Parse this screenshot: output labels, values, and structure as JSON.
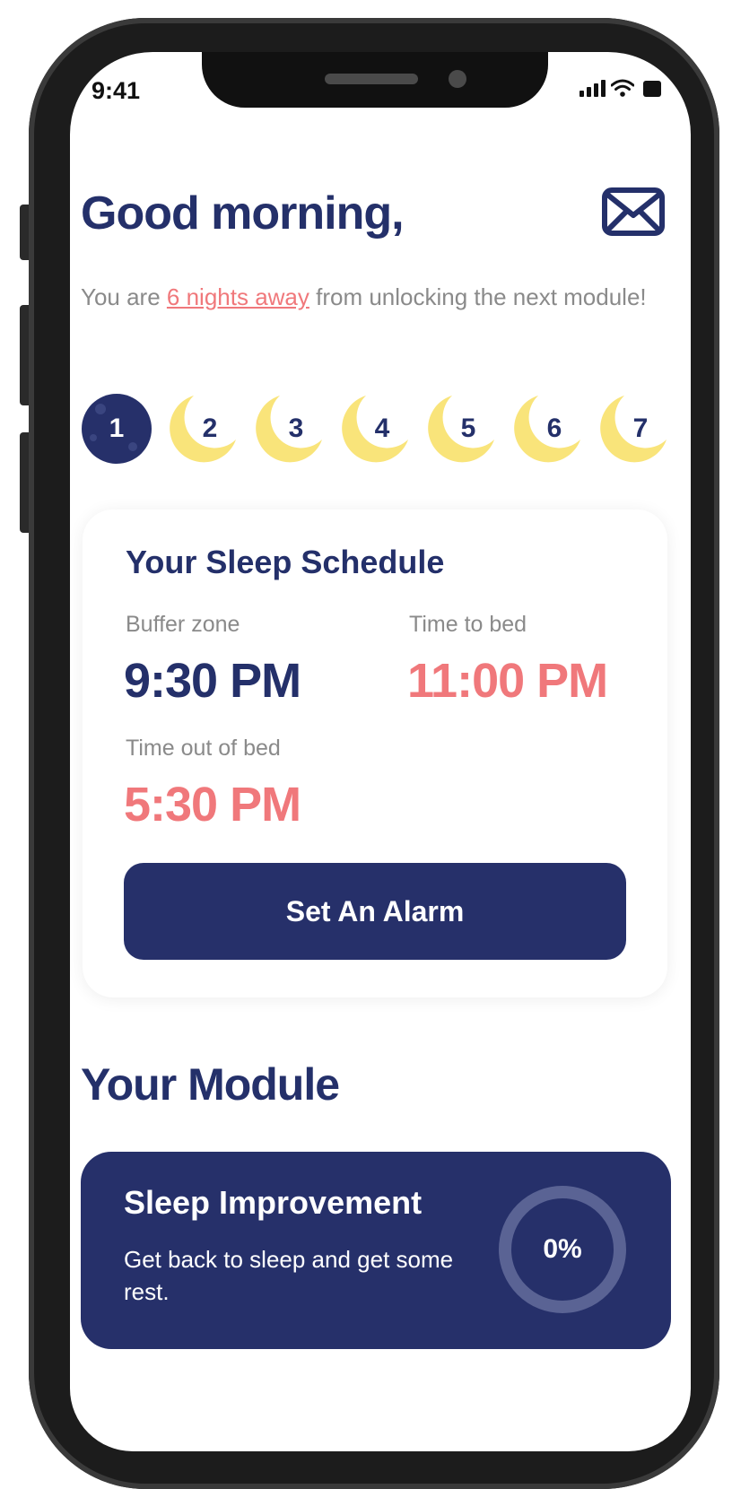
{
  "status_bar": {
    "time": "9:41"
  },
  "header": {
    "greeting": "Good morning,",
    "subtitle_prefix": "You are ",
    "subtitle_highlight": "6 nights away",
    "subtitle_suffix": " from unlocking the next module!"
  },
  "nights": {
    "current": 1,
    "items": [
      "1",
      "2",
      "3",
      "4",
      "5",
      "6",
      "7"
    ]
  },
  "schedule": {
    "title": "Your Sleep Schedule",
    "buffer_zone": {
      "label": "Buffer zone",
      "value": "9:30 PM"
    },
    "time_to_bed": {
      "label": "Time to bed",
      "value": "11:00 PM"
    },
    "time_out_of_bed": {
      "label": "Time out of bed",
      "value": "5:30 PM"
    },
    "alarm_button_label": "Set An Alarm"
  },
  "module": {
    "heading": "Your Module",
    "title": "Sleep Improvement",
    "description": "Get back to sleep and get some rest.",
    "progress_label": "0%",
    "progress": 0
  },
  "colors": {
    "navy": "#24306a",
    "coral": "#f0787b",
    "moon_yellow": "#f9e47a",
    "muted_text": "#8a8a8a"
  },
  "icons": {
    "mail": "mail-icon",
    "signal": "cellular-signal-icon",
    "wifi": "wifi-icon",
    "battery": "battery-icon",
    "crescent": "crescent-moon-icon",
    "full_moon": "full-moon-icon"
  }
}
